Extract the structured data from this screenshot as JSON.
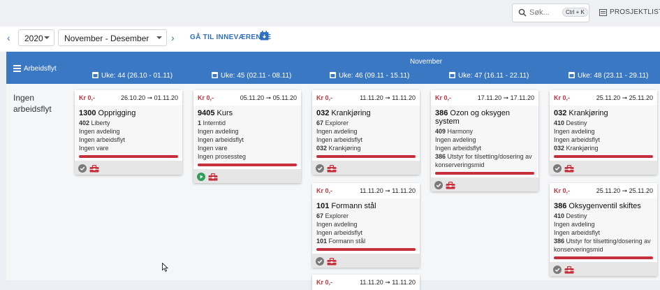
{
  "topbar": {
    "search_placeholder": "Søk...",
    "search_shortcut": "Ctrl + K",
    "project_list": "PROSJEKTLISTE"
  },
  "toolbar": {
    "year": "2020",
    "period": "November - Desember",
    "goto_current": "GÅ TIL INNEVÆRENDE"
  },
  "board": {
    "header_left": "Arbeidsflyt",
    "month": "November",
    "weeks": [
      "Uke: 44 (26.10 - 01.11)",
      "Uke: 45 (02.11 - 08.11)",
      "Uke: 46 (09.11 - 15.11)",
      "Uke: 47 (16.11 - 22.11)",
      "Uke: 48 (23.11 - 29.11)"
    ],
    "row_label": "Ingen arbeidsflyt"
  },
  "cards": [
    {
      "price": "Kr 0,-",
      "dates": "26.10.20 ➞ 01.11.20",
      "title_num": "1300",
      "title": "Opprigging",
      "lines": [
        {
          "num": "402",
          "text": "Liberty"
        },
        {
          "num": "",
          "text": "Ingen avdeling"
        },
        {
          "num": "",
          "text": "Ingen arbeidsflyt"
        },
        {
          "num": "",
          "text": "Ingen vare"
        }
      ],
      "status_icon": "check-icon"
    },
    {
      "price": "Kr 0,-",
      "dates": "05.11.20 ➞ 05.11.20",
      "title_num": "9405",
      "title": "Kurs",
      "lines": [
        {
          "num": "1",
          "text": "Interntid"
        },
        {
          "num": "",
          "text": "Ingen avdeling"
        },
        {
          "num": "",
          "text": "Ingen arbeidsflyt"
        },
        {
          "num": "",
          "text": "Ingen vare"
        },
        {
          "num": "",
          "text": "Ingen prosessteg"
        }
      ],
      "status_icon": "play-icon"
    },
    {
      "price": "Kr 0,-",
      "dates": "11.11.20 ➞ 11.11.20",
      "title_num": "032",
      "title": "Krankjøring",
      "lines": [
        {
          "num": "67",
          "text": "Explorer"
        },
        {
          "num": "",
          "text": "Ingen avdeling"
        },
        {
          "num": "",
          "text": "Ingen arbeidsflyt"
        },
        {
          "num": "032",
          "text": "Krankjøring"
        }
      ],
      "status_icon": "check-icon"
    },
    {
      "price": "Kr 0,-",
      "dates": "11.11.20 ➞ 11.11.20",
      "title_num": "101",
      "title": "Formann stål",
      "lines": [
        {
          "num": "67",
          "text": "Explorer"
        },
        {
          "num": "",
          "text": "Ingen avdeling"
        },
        {
          "num": "",
          "text": "Ingen arbeidsflyt"
        },
        {
          "num": "101",
          "text": "Formann stål"
        }
      ],
      "status_icon": "check-icon"
    },
    {
      "price": "Kr 0,-",
      "dates": "11.11.20 ➞ 11.11.20",
      "title_num": "",
      "title": "",
      "lines": [],
      "status_icon": ""
    },
    {
      "price": "Kr 0,-",
      "dates": "17.11.20 ➞ 17.11.20",
      "title_num": "386",
      "title": "Ozon og oksygen system",
      "lines": [
        {
          "num": "409",
          "text": "Harmony"
        },
        {
          "num": "",
          "text": "Ingen avdeling"
        },
        {
          "num": "",
          "text": "Ingen arbeidsflyt"
        },
        {
          "num": "386",
          "text": "Utstyr for tilsetting/dosering av konserveringsmid"
        }
      ],
      "status_icon": "check-icon"
    },
    {
      "price": "Kr 0,-",
      "dates": "25.11.20 ➞ 25.11.20",
      "title_num": "032",
      "title": "Krankjøring",
      "lines": [
        {
          "num": "410",
          "text": "Destiny"
        },
        {
          "num": "",
          "text": "Ingen avdeling"
        },
        {
          "num": "",
          "text": "Ingen arbeidsflyt"
        },
        {
          "num": "032",
          "text": "Krankjøring"
        }
      ],
      "status_icon": "check-icon"
    },
    {
      "price": "Kr 0,-",
      "dates": "25.11.20 ➞ 25.11.20",
      "title_num": "386",
      "title": "Oksygenventil skiftes",
      "lines": [
        {
          "num": "410",
          "text": "Destiny"
        },
        {
          "num": "",
          "text": "Ingen avdeling"
        },
        {
          "num": "",
          "text": "Ingen arbeidsflyt"
        },
        {
          "num": "386",
          "text": "Utstyr for tilsetting/dosering av konserveringsmid"
        }
      ],
      "status_icon": "check-icon"
    }
  ],
  "colors": {
    "header_blue": "#3b78c4",
    "accent_red": "#c5303c",
    "link_blue": "#2f6fbf",
    "play_green": "#2f9e5a"
  }
}
